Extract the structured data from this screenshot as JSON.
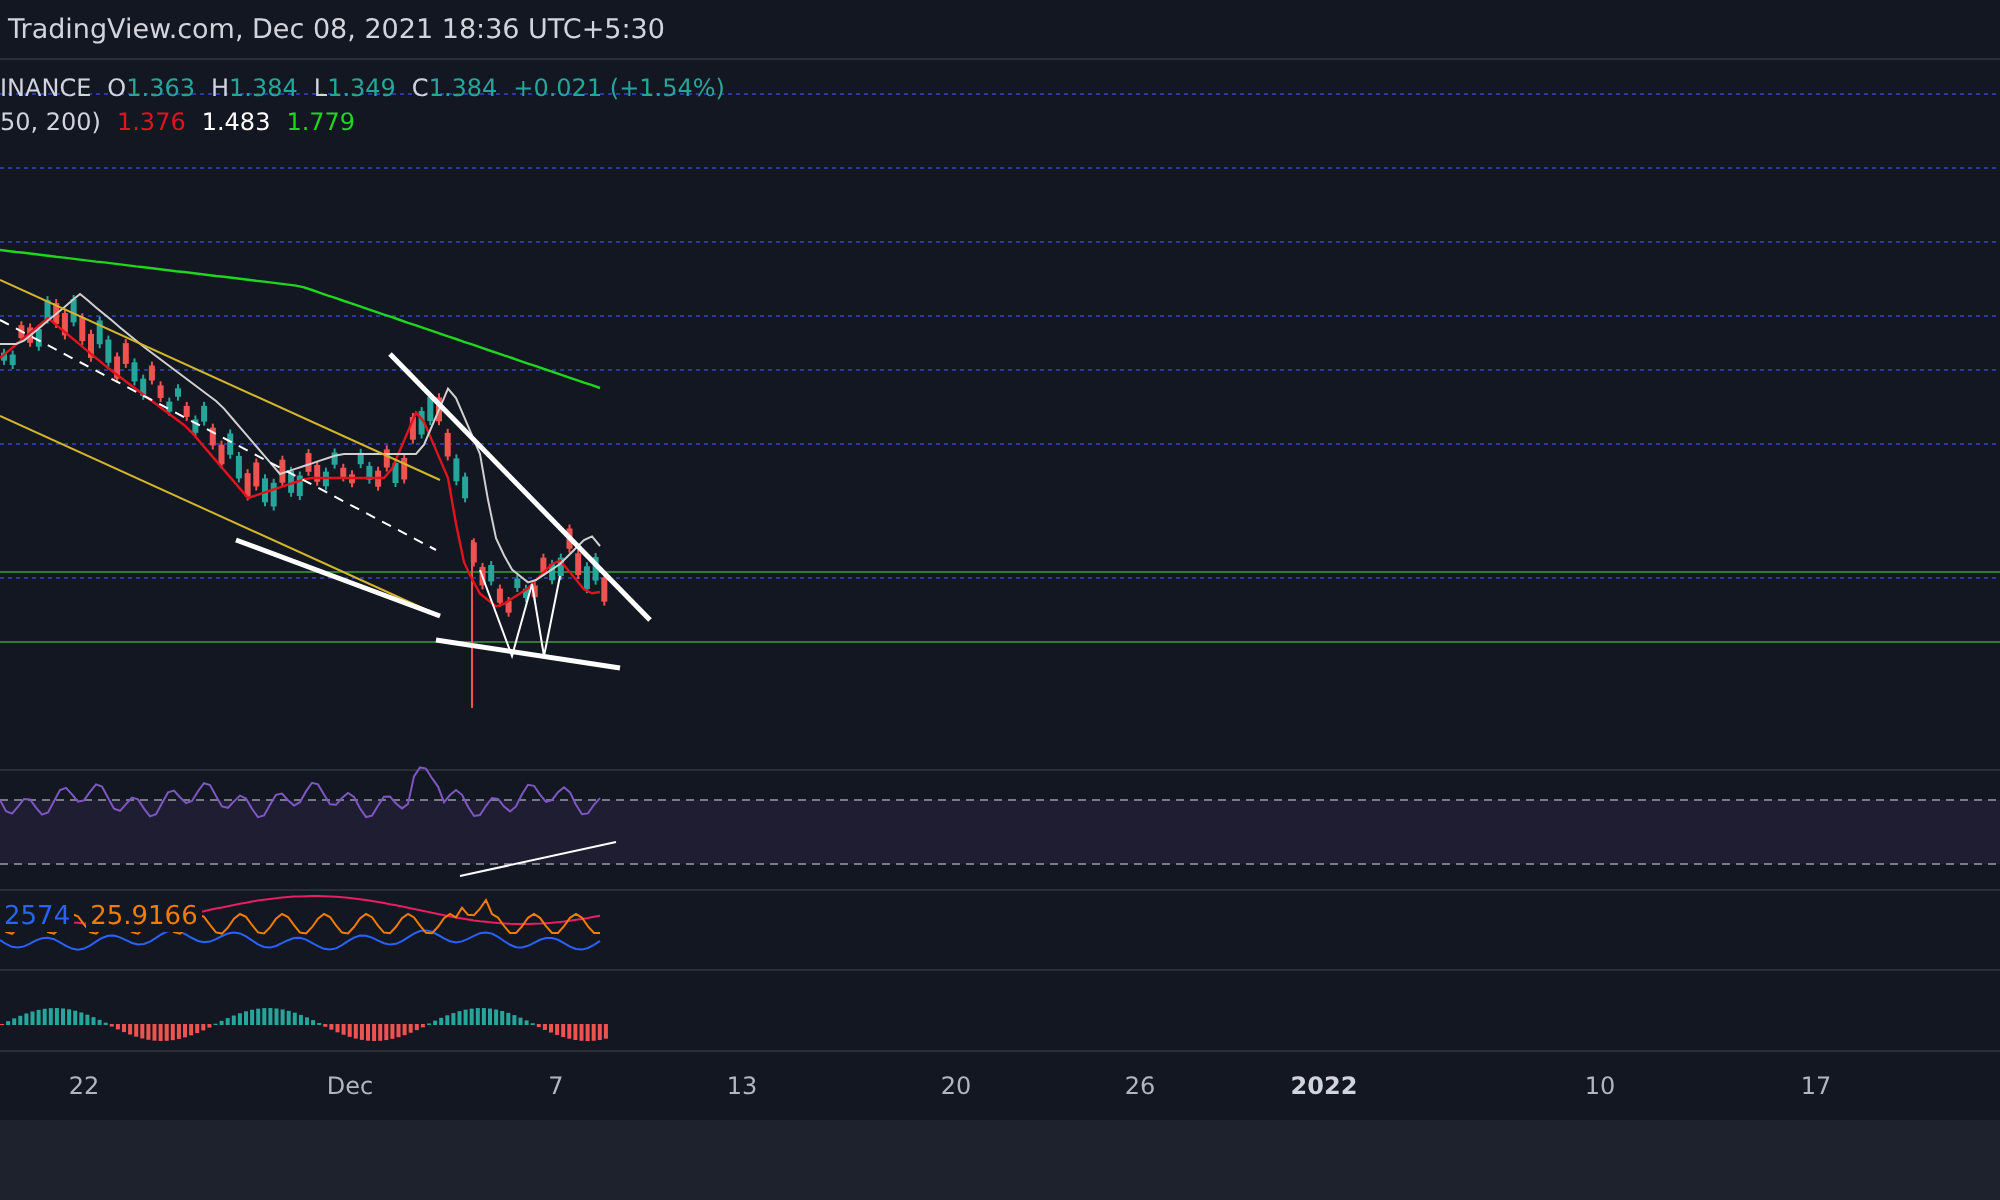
{
  "header": {
    "title": "TradingView.com, Dec 08, 2021 18:36 UTC+5:30"
  },
  "legend": {
    "symbol": "INANCE",
    "ohlc": [
      {
        "label": "O",
        "value": "1.363"
      },
      {
        "label": "H",
        "value": "1.384"
      },
      {
        "label": "L",
        "value": "1.349"
      },
      {
        "label": "C",
        "value": "1.384"
      }
    ],
    "change": "+0.021 (+1.54%)",
    "ma_params": "50, 200)",
    "ma_values": [
      {
        "value": "1.376",
        "color": "#e0141e"
      },
      {
        "value": "1.483",
        "color": "#ffffff"
      },
      {
        "value": "1.779",
        "color": "#1ed61e"
      }
    ]
  },
  "dmi_legend": [
    {
      "value": "2574",
      "color": "#2962ff"
    },
    {
      "value": "25.9166",
      "color": "#f57c00"
    }
  ],
  "time_axis": [
    {
      "label": "22",
      "kind": "day"
    },
    {
      "label": "Dec",
      "kind": "month"
    },
    {
      "label": "7",
      "kind": "day"
    },
    {
      "label": "13",
      "kind": "day"
    },
    {
      "label": "20",
      "kind": "day"
    },
    {
      "label": "26",
      "kind": "day"
    },
    {
      "label": "2022",
      "kind": "year"
    },
    {
      "label": "10",
      "kind": "day"
    },
    {
      "label": "17",
      "kind": "day"
    }
  ]
}
